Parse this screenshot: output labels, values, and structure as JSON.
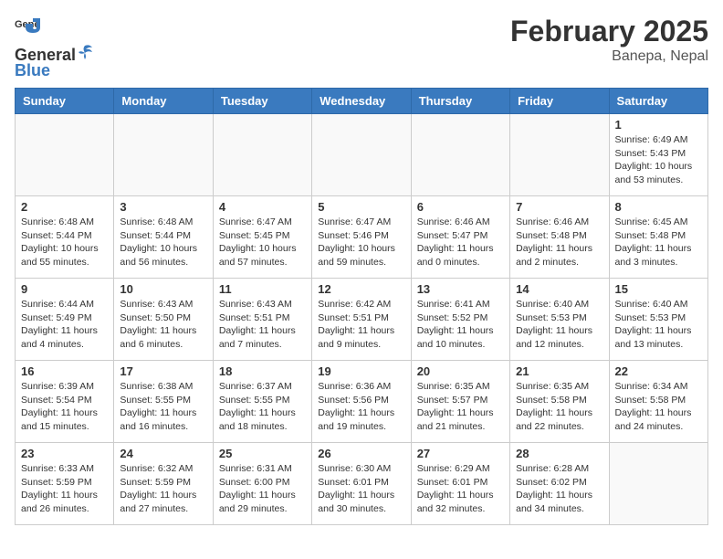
{
  "header": {
    "logo_general": "General",
    "logo_blue": "Blue",
    "month_title": "February 2025",
    "location": "Banepa, Nepal"
  },
  "weekdays": [
    "Sunday",
    "Monday",
    "Tuesday",
    "Wednesday",
    "Thursday",
    "Friday",
    "Saturday"
  ],
  "weeks": [
    [
      {
        "day": "",
        "info": ""
      },
      {
        "day": "",
        "info": ""
      },
      {
        "day": "",
        "info": ""
      },
      {
        "day": "",
        "info": ""
      },
      {
        "day": "",
        "info": ""
      },
      {
        "day": "",
        "info": ""
      },
      {
        "day": "1",
        "info": "Sunrise: 6:49 AM\nSunset: 5:43 PM\nDaylight: 10 hours and 53 minutes."
      }
    ],
    [
      {
        "day": "2",
        "info": "Sunrise: 6:48 AM\nSunset: 5:44 PM\nDaylight: 10 hours and 55 minutes."
      },
      {
        "day": "3",
        "info": "Sunrise: 6:48 AM\nSunset: 5:44 PM\nDaylight: 10 hours and 56 minutes."
      },
      {
        "day": "4",
        "info": "Sunrise: 6:47 AM\nSunset: 5:45 PM\nDaylight: 10 hours and 57 minutes."
      },
      {
        "day": "5",
        "info": "Sunrise: 6:47 AM\nSunset: 5:46 PM\nDaylight: 10 hours and 59 minutes."
      },
      {
        "day": "6",
        "info": "Sunrise: 6:46 AM\nSunset: 5:47 PM\nDaylight: 11 hours and 0 minutes."
      },
      {
        "day": "7",
        "info": "Sunrise: 6:46 AM\nSunset: 5:48 PM\nDaylight: 11 hours and 2 minutes."
      },
      {
        "day": "8",
        "info": "Sunrise: 6:45 AM\nSunset: 5:48 PM\nDaylight: 11 hours and 3 minutes."
      }
    ],
    [
      {
        "day": "9",
        "info": "Sunrise: 6:44 AM\nSunset: 5:49 PM\nDaylight: 11 hours and 4 minutes."
      },
      {
        "day": "10",
        "info": "Sunrise: 6:43 AM\nSunset: 5:50 PM\nDaylight: 11 hours and 6 minutes."
      },
      {
        "day": "11",
        "info": "Sunrise: 6:43 AM\nSunset: 5:51 PM\nDaylight: 11 hours and 7 minutes."
      },
      {
        "day": "12",
        "info": "Sunrise: 6:42 AM\nSunset: 5:51 PM\nDaylight: 11 hours and 9 minutes."
      },
      {
        "day": "13",
        "info": "Sunrise: 6:41 AM\nSunset: 5:52 PM\nDaylight: 11 hours and 10 minutes."
      },
      {
        "day": "14",
        "info": "Sunrise: 6:40 AM\nSunset: 5:53 PM\nDaylight: 11 hours and 12 minutes."
      },
      {
        "day": "15",
        "info": "Sunrise: 6:40 AM\nSunset: 5:53 PM\nDaylight: 11 hours and 13 minutes."
      }
    ],
    [
      {
        "day": "16",
        "info": "Sunrise: 6:39 AM\nSunset: 5:54 PM\nDaylight: 11 hours and 15 minutes."
      },
      {
        "day": "17",
        "info": "Sunrise: 6:38 AM\nSunset: 5:55 PM\nDaylight: 11 hours and 16 minutes."
      },
      {
        "day": "18",
        "info": "Sunrise: 6:37 AM\nSunset: 5:55 PM\nDaylight: 11 hours and 18 minutes."
      },
      {
        "day": "19",
        "info": "Sunrise: 6:36 AM\nSunset: 5:56 PM\nDaylight: 11 hours and 19 minutes."
      },
      {
        "day": "20",
        "info": "Sunrise: 6:35 AM\nSunset: 5:57 PM\nDaylight: 11 hours and 21 minutes."
      },
      {
        "day": "21",
        "info": "Sunrise: 6:35 AM\nSunset: 5:58 PM\nDaylight: 11 hours and 22 minutes."
      },
      {
        "day": "22",
        "info": "Sunrise: 6:34 AM\nSunset: 5:58 PM\nDaylight: 11 hours and 24 minutes."
      }
    ],
    [
      {
        "day": "23",
        "info": "Sunrise: 6:33 AM\nSunset: 5:59 PM\nDaylight: 11 hours and 26 minutes."
      },
      {
        "day": "24",
        "info": "Sunrise: 6:32 AM\nSunset: 5:59 PM\nDaylight: 11 hours and 27 minutes."
      },
      {
        "day": "25",
        "info": "Sunrise: 6:31 AM\nSunset: 6:00 PM\nDaylight: 11 hours and 29 minutes."
      },
      {
        "day": "26",
        "info": "Sunrise: 6:30 AM\nSunset: 6:01 PM\nDaylight: 11 hours and 30 minutes."
      },
      {
        "day": "27",
        "info": "Sunrise: 6:29 AM\nSunset: 6:01 PM\nDaylight: 11 hours and 32 minutes."
      },
      {
        "day": "28",
        "info": "Sunrise: 6:28 AM\nSunset: 6:02 PM\nDaylight: 11 hours and 34 minutes."
      },
      {
        "day": "",
        "info": ""
      }
    ]
  ]
}
